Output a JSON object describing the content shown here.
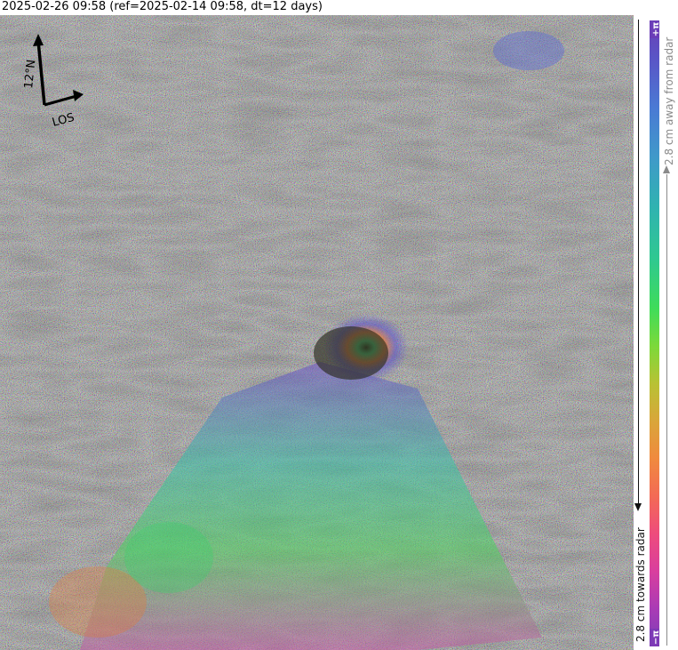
{
  "title": "2025-02-26 09:58 (ref=2025-02-14 09:58, dt=12 days)",
  "compass": {
    "north_label": "12°N",
    "los_label": "LOS",
    "icon": "north-arrow-icon"
  },
  "colorbar": {
    "top_label": "+π",
    "bottom_label": "−π",
    "towards_label": "2.8 cm towards radar",
    "away_label": "2.8 cm away from radar",
    "palette": [
      "#6a3fb5",
      "#4a7ad4",
      "#2fb3b0",
      "#3fdc5a",
      "#b8c234",
      "#f08a3e",
      "#ee4c7c",
      "#a93bb5"
    ]
  },
  "image": {
    "description_icon": "interferogram-image",
    "colors": {
      "background": "#7a7a7a",
      "noise_mix": [
        "#8a6fb0",
        "#5fae8a",
        "#b07a6a",
        "#6f8fb0",
        "#9a9a6a"
      ]
    }
  }
}
